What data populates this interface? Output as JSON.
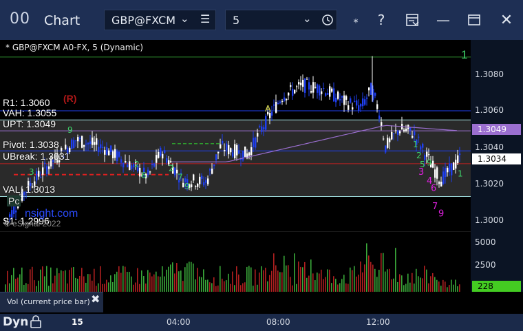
{
  "titlebar": {
    "app_icon": "00",
    "title": "Chart",
    "symbol": "GBP@FXCM",
    "interval": "5"
  },
  "legend": "* GBP@FXCM A0-FX, 5 (Dynamic)",
  "levels": {
    "r1": "R1: 1.3060",
    "r_marker": "(R)",
    "vah": "VAH: 1.3055",
    "upt": "UPT: 1.3049",
    "pivot": "Pivot: 1.3038",
    "ubreak": "UBreak: 1.3031",
    "val": "VAL: 1.3013",
    "s1": "S1: 1.2996",
    "a_marker": "A",
    "one_marker": "1",
    "pc": "Pc",
    "watermark": "nsight.com",
    "copyright": "© eSignal 2022"
  },
  "price_axis": {
    "ticks": [
      "1.3080",
      "1.3060",
      "1.3040",
      "1.3020",
      "1.3000"
    ],
    "tag_purple": "1.3049",
    "tag_last": "1.3034"
  },
  "volume_axis": {
    "ticks": [
      "5000",
      "2500"
    ],
    "last": "228"
  },
  "volume_panel": {
    "label": "Vol (current price bar)"
  },
  "time_axis": {
    "dyn": "Dyn",
    "labels": [
      "15",
      "04:00",
      "08:00",
      "12:00"
    ]
  },
  "colors": {
    "up_bar": "#ffffff",
    "down_bar": "#1f3ff0",
    "vol_up": "#3aa83a",
    "vol_down": "#b02020",
    "purple": "#9b6fd0",
    "green_sig": "#3fd36a",
    "magenta_sig": "#e020e0"
  }
}
